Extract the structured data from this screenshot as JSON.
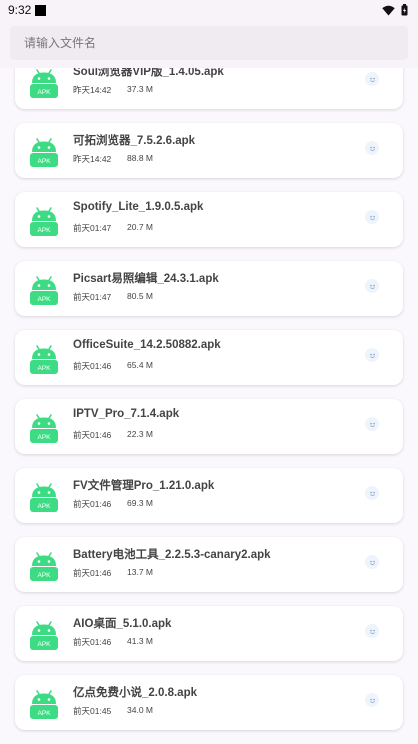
{
  "status_bar": {
    "time": "9:32",
    "icons": [
      "notification-square-icon",
      "wifi-icon",
      "battery-icon"
    ]
  },
  "search": {
    "placeholder": "请输入文件名",
    "value": ""
  },
  "colors": {
    "apk_green": "#3ddc84",
    "background": "#fbf8fd",
    "card": "#ffffff",
    "text": "#444444"
  },
  "files": [
    {
      "name": "Soul浏览器VIP版_1.4.05.apk",
      "time": "昨天14:42",
      "size": "37.3 M",
      "badge": "APK"
    },
    {
      "name": "可拓浏览器_7.5.2.6.apk",
      "time": "昨天14:42",
      "size": "88.8 M",
      "badge": "APK"
    },
    {
      "name": "Spotify_Lite_1.9.0.5.apk",
      "time": "前天01:47",
      "size": "20.7 M",
      "badge": "APK"
    },
    {
      "name": "Picsart易照编辑_24.3.1.apk",
      "time": "前天01:47",
      "size": "80.5 M",
      "badge": "APK"
    },
    {
      "name": "OfficeSuite_14.2.50882.apk",
      "time": "前天01:46",
      "size": "65.4 M",
      "badge": "APK"
    },
    {
      "name": "IPTV_Pro_7.1.4.apk",
      "time": "前天01:46",
      "size": "22.3 M",
      "badge": "APK"
    },
    {
      "name": "FV文件管理Pro_1.21.0.apk",
      "time": "前天01:46",
      "size": "69.3 M",
      "badge": "APK"
    },
    {
      "name": "Battery电池工具_2.2.5.3-canary2.apk",
      "time": "前天01:46",
      "size": "13.7 M",
      "badge": "APK"
    },
    {
      "name": "AIO桌面_5.1.0.apk",
      "time": "前天01:46",
      "size": "41.3 M",
      "badge": "APK"
    },
    {
      "name": "亿点免费小说_2.0.8.apk",
      "time": "前天01:45",
      "size": "34.0 M",
      "badge": "APK"
    }
  ]
}
